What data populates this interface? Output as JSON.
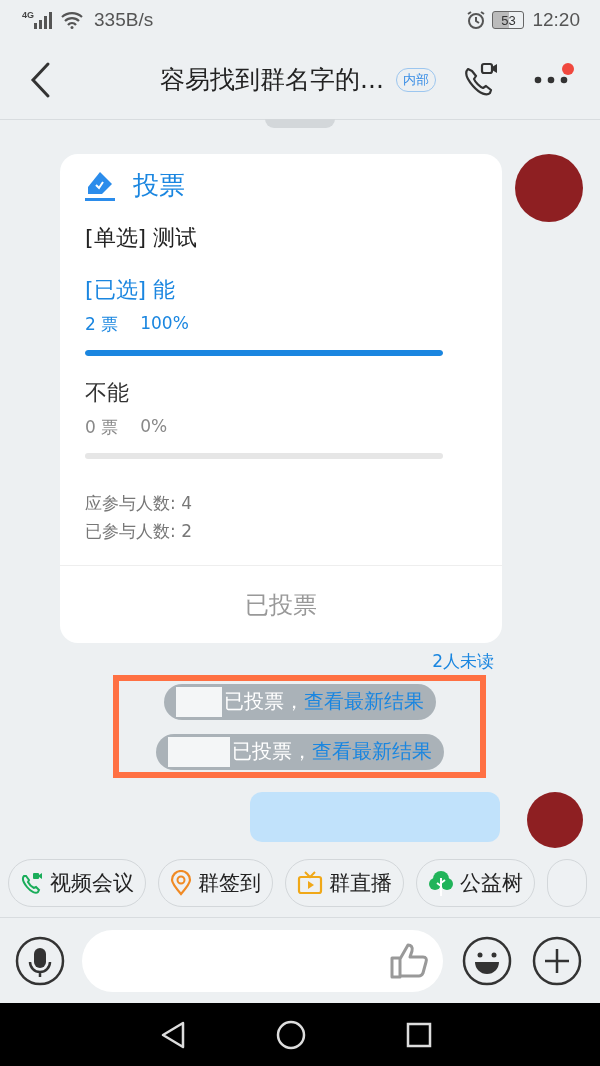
{
  "status_bar": {
    "network": "4G",
    "speed": "335B/s",
    "battery": "53",
    "time": "12:20"
  },
  "header": {
    "title": "容易找到群名字的...",
    "tag": "内部",
    "menu_badge": true
  },
  "vote_card": {
    "title": "投票",
    "question": "[单选] 测试",
    "options": [
      {
        "label": "[已选] 能",
        "selected": true,
        "votes": "2 票",
        "percent": "100%",
        "level": 1
      },
      {
        "label": "不能",
        "selected": false,
        "votes": "0 票",
        "percent": "0%"
      }
    ],
    "stats": [
      "应参与人数: 4",
      "已参与人数: 2"
    ],
    "footer": "已投票"
  },
  "unread": "2人未读",
  "notices": [
    {
      "text": "已投票，",
      "link": "查看最新结果"
    },
    {
      "text": "已投票，",
      "link": "查看最新结果"
    }
  ],
  "shortcuts": [
    {
      "label": "视频会议",
      "kind": "video"
    },
    {
      "label": "群签到",
      "kind": "checkin"
    },
    {
      "label": "群直播",
      "kind": "live"
    },
    {
      "label": "公益树",
      "kind": "tree"
    }
  ]
}
